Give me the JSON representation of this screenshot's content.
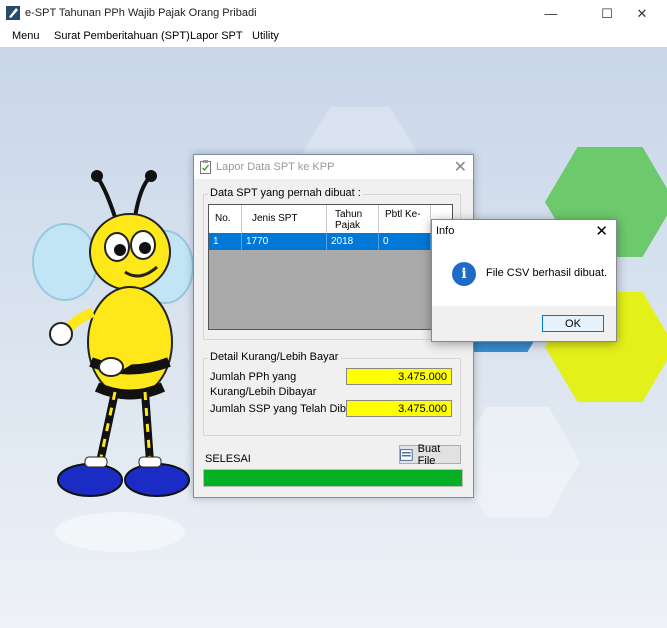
{
  "window": {
    "title": "e-SPT Tahunan PPh Wajib Pajak Orang Pribadi",
    "minimize_glyph": "—",
    "maximize_glyph": "☐",
    "close_glyph": "✕"
  },
  "menu": [
    "Menu",
    "Surat Pemberitahuan (SPT)",
    "Lapor SPT",
    "Utility"
  ],
  "dialog": {
    "title": "Lapor Data SPT ke KPP",
    "close_glyph": "✕",
    "group1_label": "Data SPT yang pernah dibuat :",
    "columns": [
      "No.",
      "Jenis SPT",
      "Tahun Pajak",
      "Pbtl Ke-"
    ],
    "rows": [
      [
        "1",
        "1770",
        "2018",
        "0"
      ]
    ],
    "group2_label": "Detail Kurang/Lebih Bayar",
    "field1_label": "Jumlah PPh yang Kurang/Lebih Dibayar",
    "field1_value": "3.475.000",
    "field2_label": "Jumlah SSP yang Telah Dibayar",
    "field2_value": "3.475.000",
    "status": "SELESAI",
    "button_label": "Buat File",
    "progress": 1.0
  },
  "info": {
    "title": "Info",
    "close_glyph": "✕",
    "message": "File CSV berhasil dibuat.",
    "icon_glyph": "i",
    "ok_label": "OK"
  },
  "colors": {
    "selection": "#0078d7",
    "progress": "#06b025",
    "field_bg": "#ffff00"
  }
}
